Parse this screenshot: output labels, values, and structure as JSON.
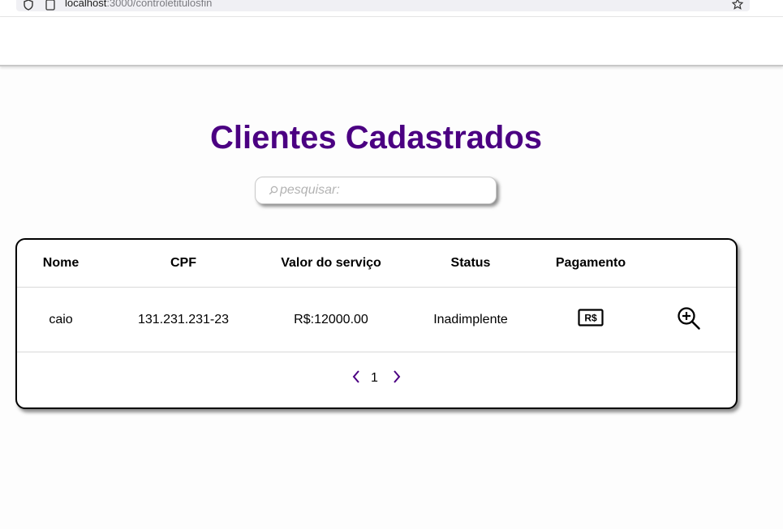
{
  "browser": {
    "url_host": "localhost",
    "url_path": ":3000/controletitulosfin"
  },
  "page": {
    "title": "Clientes Cadastrados"
  },
  "search": {
    "placeholder": "pesquisar:",
    "value": ""
  },
  "table": {
    "headers": {
      "nome": "Nome",
      "cpf": "CPF",
      "valor": "Valor do serviço",
      "status": "Status",
      "pagamento": "Pagamento"
    },
    "rows": [
      {
        "nome": "caio",
        "cpf": "131.231.231-23",
        "valor": "R$:12000.00",
        "status": "Inadimplente",
        "payment_icon": "R$",
        "details_icon": "zoom-in-icon"
      }
    ]
  },
  "pagination": {
    "current_page": "1"
  },
  "colors": {
    "title": "#4b0082",
    "pager_arrows": "#4b0082"
  }
}
